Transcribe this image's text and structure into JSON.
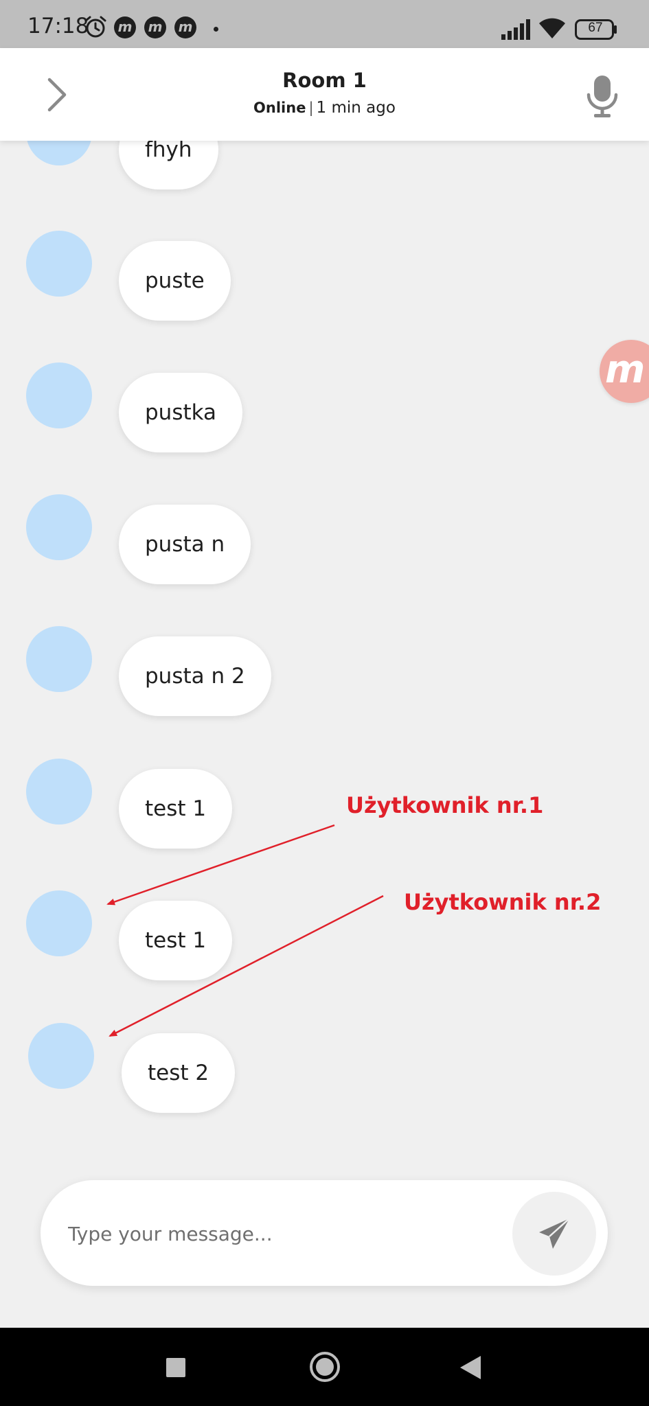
{
  "status_bar": {
    "time": "17:18",
    "app_icon_letter": "m",
    "battery": "67",
    "icons": [
      "alarm-icon",
      "app-notification-icon",
      "signal-icon",
      "wifi-icon",
      "battery-icon"
    ]
  },
  "header": {
    "title": "Room 1",
    "status": "Online",
    "separator": "|",
    "last_seen": "1 min ago",
    "icons": [
      "chevron-right-icon",
      "microphone-icon"
    ]
  },
  "messages": [
    {
      "text": "fhyh"
    },
    {
      "text": "puste"
    },
    {
      "text": "pustka"
    },
    {
      "text": "pusta n"
    },
    {
      "text": "pusta n 2"
    },
    {
      "text": "test 1"
    },
    {
      "text": "test 1"
    },
    {
      "text": "test 2"
    }
  ],
  "floating_badge": {
    "letter": "m"
  },
  "annotations": {
    "user1": "Użytkownik nr.1",
    "user2": "Użytkownik nr.2"
  },
  "composer": {
    "placeholder": "Type your message...",
    "value": "",
    "send_icon": "send-icon"
  },
  "nav_bar": {
    "icons": [
      "recents-icon",
      "home-icon",
      "back-icon"
    ]
  },
  "colors": {
    "status_bar": "#bebebe",
    "background": "#f0f0f0",
    "avatar": "#bfdffa",
    "annotation": "#e0202a",
    "badge": "#f0aca5"
  }
}
